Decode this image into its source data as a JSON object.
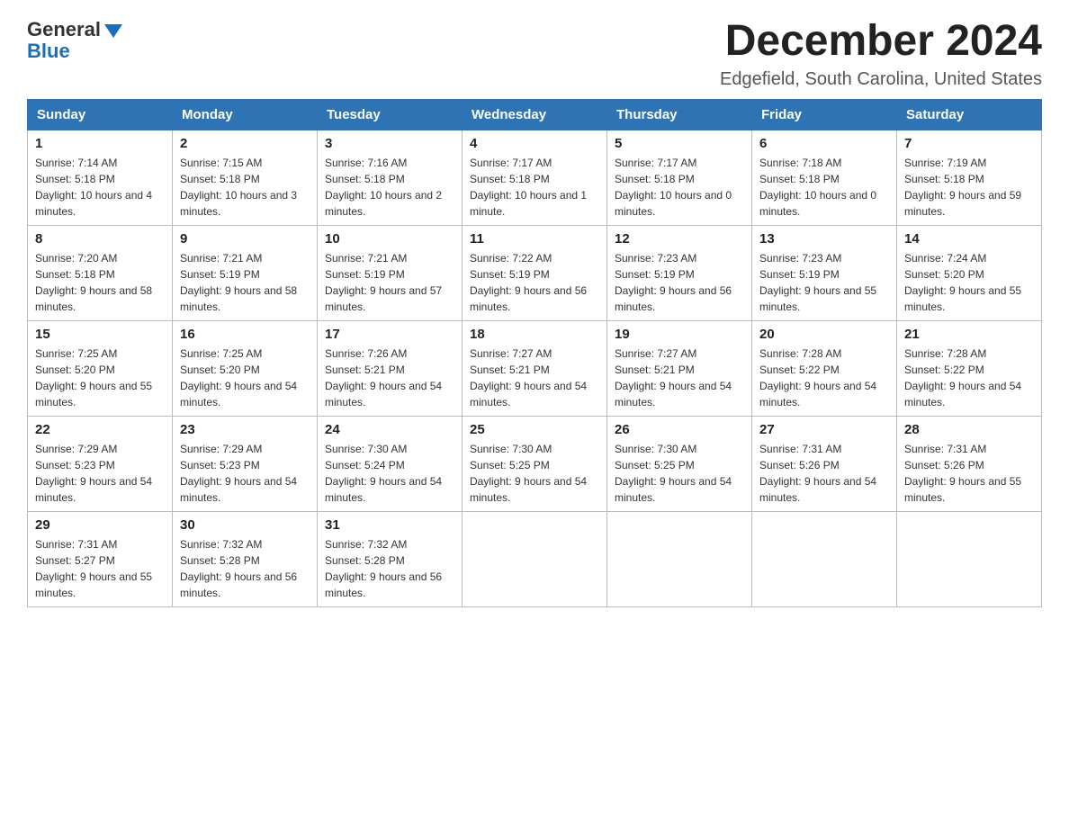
{
  "logo": {
    "line1": "General",
    "triangle": "▶",
    "line2": "Blue"
  },
  "header": {
    "month": "December 2024",
    "location": "Edgefield, South Carolina, United States"
  },
  "weekdays": [
    "Sunday",
    "Monday",
    "Tuesday",
    "Wednesday",
    "Thursday",
    "Friday",
    "Saturday"
  ],
  "weeks": [
    [
      {
        "day": "1",
        "sunrise": "7:14 AM",
        "sunset": "5:18 PM",
        "daylight": "10 hours and 4 minutes."
      },
      {
        "day": "2",
        "sunrise": "7:15 AM",
        "sunset": "5:18 PM",
        "daylight": "10 hours and 3 minutes."
      },
      {
        "day": "3",
        "sunrise": "7:16 AM",
        "sunset": "5:18 PM",
        "daylight": "10 hours and 2 minutes."
      },
      {
        "day": "4",
        "sunrise": "7:17 AM",
        "sunset": "5:18 PM",
        "daylight": "10 hours and 1 minute."
      },
      {
        "day": "5",
        "sunrise": "7:17 AM",
        "sunset": "5:18 PM",
        "daylight": "10 hours and 0 minutes."
      },
      {
        "day": "6",
        "sunrise": "7:18 AM",
        "sunset": "5:18 PM",
        "daylight": "10 hours and 0 minutes."
      },
      {
        "day": "7",
        "sunrise": "7:19 AM",
        "sunset": "5:18 PM",
        "daylight": "9 hours and 59 minutes."
      }
    ],
    [
      {
        "day": "8",
        "sunrise": "7:20 AM",
        "sunset": "5:18 PM",
        "daylight": "9 hours and 58 minutes."
      },
      {
        "day": "9",
        "sunrise": "7:21 AM",
        "sunset": "5:19 PM",
        "daylight": "9 hours and 58 minutes."
      },
      {
        "day": "10",
        "sunrise": "7:21 AM",
        "sunset": "5:19 PM",
        "daylight": "9 hours and 57 minutes."
      },
      {
        "day": "11",
        "sunrise": "7:22 AM",
        "sunset": "5:19 PM",
        "daylight": "9 hours and 56 minutes."
      },
      {
        "day": "12",
        "sunrise": "7:23 AM",
        "sunset": "5:19 PM",
        "daylight": "9 hours and 56 minutes."
      },
      {
        "day": "13",
        "sunrise": "7:23 AM",
        "sunset": "5:19 PM",
        "daylight": "9 hours and 55 minutes."
      },
      {
        "day": "14",
        "sunrise": "7:24 AM",
        "sunset": "5:20 PM",
        "daylight": "9 hours and 55 minutes."
      }
    ],
    [
      {
        "day": "15",
        "sunrise": "7:25 AM",
        "sunset": "5:20 PM",
        "daylight": "9 hours and 55 minutes."
      },
      {
        "day": "16",
        "sunrise": "7:25 AM",
        "sunset": "5:20 PM",
        "daylight": "9 hours and 54 minutes."
      },
      {
        "day": "17",
        "sunrise": "7:26 AM",
        "sunset": "5:21 PM",
        "daylight": "9 hours and 54 minutes."
      },
      {
        "day": "18",
        "sunrise": "7:27 AM",
        "sunset": "5:21 PM",
        "daylight": "9 hours and 54 minutes."
      },
      {
        "day": "19",
        "sunrise": "7:27 AM",
        "sunset": "5:21 PM",
        "daylight": "9 hours and 54 minutes."
      },
      {
        "day": "20",
        "sunrise": "7:28 AM",
        "sunset": "5:22 PM",
        "daylight": "9 hours and 54 minutes."
      },
      {
        "day": "21",
        "sunrise": "7:28 AM",
        "sunset": "5:22 PM",
        "daylight": "9 hours and 54 minutes."
      }
    ],
    [
      {
        "day": "22",
        "sunrise": "7:29 AM",
        "sunset": "5:23 PM",
        "daylight": "9 hours and 54 minutes."
      },
      {
        "day": "23",
        "sunrise": "7:29 AM",
        "sunset": "5:23 PM",
        "daylight": "9 hours and 54 minutes."
      },
      {
        "day": "24",
        "sunrise": "7:30 AM",
        "sunset": "5:24 PM",
        "daylight": "9 hours and 54 minutes."
      },
      {
        "day": "25",
        "sunrise": "7:30 AM",
        "sunset": "5:25 PM",
        "daylight": "9 hours and 54 minutes."
      },
      {
        "day": "26",
        "sunrise": "7:30 AM",
        "sunset": "5:25 PM",
        "daylight": "9 hours and 54 minutes."
      },
      {
        "day": "27",
        "sunrise": "7:31 AM",
        "sunset": "5:26 PM",
        "daylight": "9 hours and 54 minutes."
      },
      {
        "day": "28",
        "sunrise": "7:31 AM",
        "sunset": "5:26 PM",
        "daylight": "9 hours and 55 minutes."
      }
    ],
    [
      {
        "day": "29",
        "sunrise": "7:31 AM",
        "sunset": "5:27 PM",
        "daylight": "9 hours and 55 minutes."
      },
      {
        "day": "30",
        "sunrise": "7:32 AM",
        "sunset": "5:28 PM",
        "daylight": "9 hours and 56 minutes."
      },
      {
        "day": "31",
        "sunrise": "7:32 AM",
        "sunset": "5:28 PM",
        "daylight": "9 hours and 56 minutes."
      },
      null,
      null,
      null,
      null
    ]
  ],
  "labels": {
    "sunrise": "Sunrise:",
    "sunset": "Sunset:",
    "daylight": "Daylight:"
  }
}
